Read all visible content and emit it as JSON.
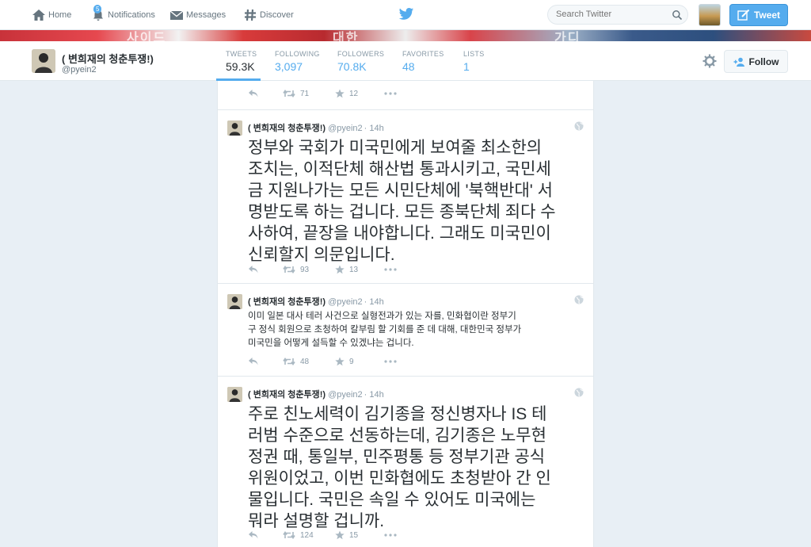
{
  "topnav": {
    "home_label": "Home",
    "notifications_label": "Notifications",
    "notifications_count": "5",
    "messages_label": "Messages",
    "discover_label": "Discover",
    "search_placeholder": "Search Twitter",
    "tweet_button_label": "Tweet"
  },
  "banner": {
    "text_fragments": [
      "사이드",
      "대한",
      "가디"
    ]
  },
  "profile": {
    "name": "( 변희재의 청춘투쟁!)",
    "handle": "@pyein2",
    "stats": {
      "tweets_label": "TWEETS",
      "tweets": "59.3K",
      "following_label": "FOLLOWING",
      "following": "3,097",
      "followers_label": "FOLLOWERS",
      "followers": "70.8K",
      "favorites_label": "FAVORITES",
      "favorites": "48",
      "lists_label": "LISTS",
      "lists": "1"
    },
    "follow_label": "Follow"
  },
  "timeline": {
    "top_partial": {
      "retweets": "71",
      "favorites": "12"
    },
    "tweets": [
      {
        "name": "( 변희재의 청춘투쟁!)",
        "handle": "@pyein2",
        "time": "· 14h",
        "lines": [
          "정부와 국회가 미국민에게 보여줄 최소한의",
          "조치는, 이적단체 해산법 통과시키고, 국민세",
          "금 지원나가는 모든 시민단체에 '북핵반대' 서",
          "명받도록 하는 겁니다. 모든 종북단체 죄다 수",
          "사하여, 끝장을 내야합니다. 그래도 미국민이",
          "신뢰할지 의문입니다."
        ],
        "retweets": "93",
        "favorites": "13"
      },
      {
        "name": "( 변희재의 청춘투쟁!)",
        "handle": "@pyein2",
        "time": "· 14h",
        "lines": [
          "이미 일본 대사 테러 사건으로 실형전과가 있는 자를, 민화협이란 정부기",
          "구 정식 회원으로 초청하여 칼부림 할 기회를 준 데 대해, 대한민국 정부가",
          "미국민을 어떻게 설득할 수 있겠냐는 겁니다."
        ],
        "retweets": "48",
        "favorites": "9"
      },
      {
        "name": "( 변희재의 청춘투쟁!)",
        "handle": "@pyein2",
        "time": "· 14h",
        "lines": [
          "주로 친노세력이 김기종을 정신병자나 IS 테",
          "러범 수준으로 선동하는데, 김기종은 노무현",
          "정권 때, 통일부, 민주평통 등 정부기관 공식",
          "위원이었고, 이번 민화협에도 초청받아 간 인",
          "물입니다. 국민은 속일 수 있어도  미국에는",
          "뭐라 설명할 겁니까."
        ],
        "retweets": "124",
        "favorites": "15"
      }
    ]
  },
  "colors": {
    "accent": "#55acee",
    "text": "#292f33",
    "muted": "#8899a6",
    "background": "#e8eff5"
  },
  "icons": [
    "home-icon",
    "notifications-icon",
    "messages-icon",
    "discover-icon",
    "twitter-bird-icon",
    "search-icon",
    "compose-icon",
    "gear-icon",
    "follow-icon",
    "reply-icon",
    "retweet-icon",
    "favorite-icon",
    "more-icon",
    "globe-icon"
  ]
}
